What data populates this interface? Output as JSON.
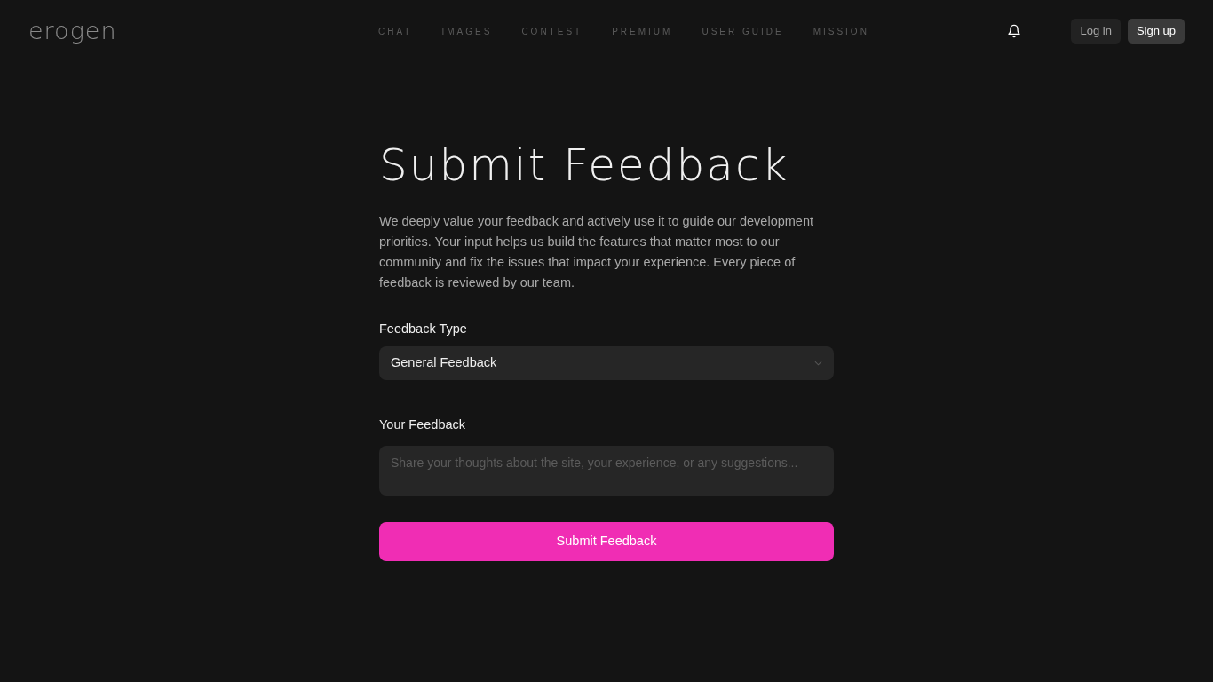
{
  "header": {
    "logo": "erogen",
    "nav": [
      "CHAT",
      "IMAGES",
      "CONTEST",
      "PREMIUM",
      "USER GUIDE",
      "MISSION"
    ],
    "buttons": [
      {
        "label": "Log in",
        "kind": "secondary"
      },
      {
        "label": "Sign up",
        "kind": "primary"
      }
    ]
  },
  "main": {
    "title": "Submit Feedback",
    "intro": "We deeply value your feedback and actively use it to guide our development priorities. Your input helps us build the features that matter most to our community and fix the issues that impact your experience. Every piece of feedback is reviewed by our team.",
    "type_field": {
      "label": "Feedback Type",
      "value": "General Feedback"
    },
    "feedback_field": {
      "label": "Your Feedback",
      "placeholder": "Share your thoughts about the site, your experience, or any suggestions..."
    },
    "submit": "Submit Feedback"
  }
}
